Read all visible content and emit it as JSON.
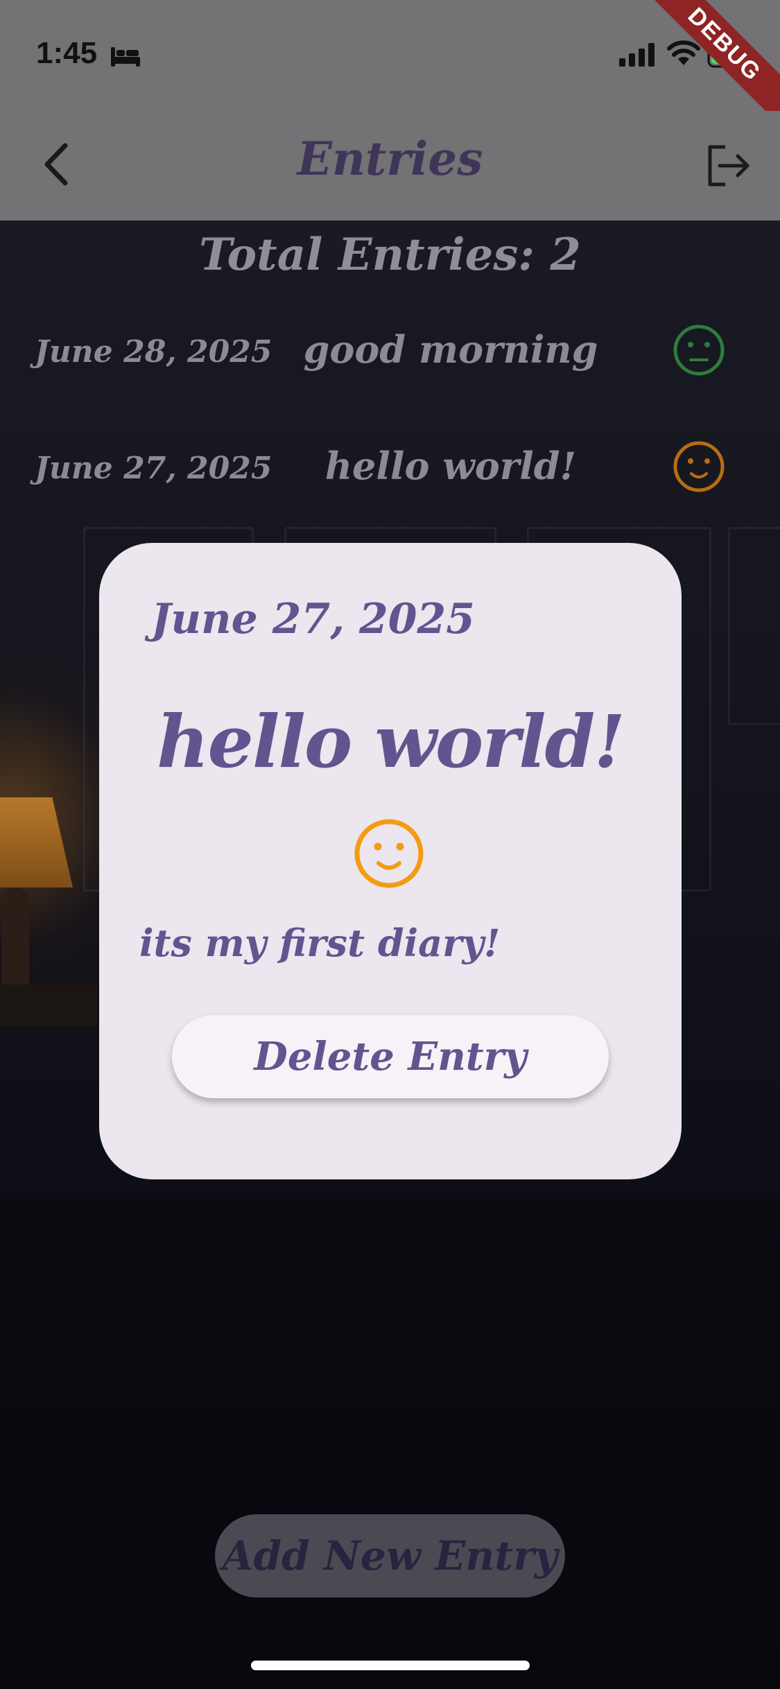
{
  "status_bar": {
    "time": "1:45",
    "debug_label": "DEBUG"
  },
  "app_bar": {
    "title": "Entries"
  },
  "summary": {
    "total_entries": "Total Entries: 2"
  },
  "entries": [
    {
      "date": "June 28, 2025",
      "title": "good morning",
      "mood": "neutral-face-icon",
      "mood_color": "#2e8b3e"
    },
    {
      "date": "June 27, 2025",
      "title": "hello world!",
      "mood": "smile-face-icon",
      "mood_color": "#c87a14"
    }
  ],
  "dialog": {
    "date": "June 27, 2025",
    "title": "hello world!",
    "mood": "smile-face-icon",
    "mood_color": "#f39c12",
    "body": "its my first diary!",
    "delete_label": "Delete Entry"
  },
  "footer": {
    "add_label": "Add New Entry"
  },
  "colors": {
    "accent": "#63548f",
    "dialog_bg": "#ece6ee",
    "scrim": "#737274"
  }
}
